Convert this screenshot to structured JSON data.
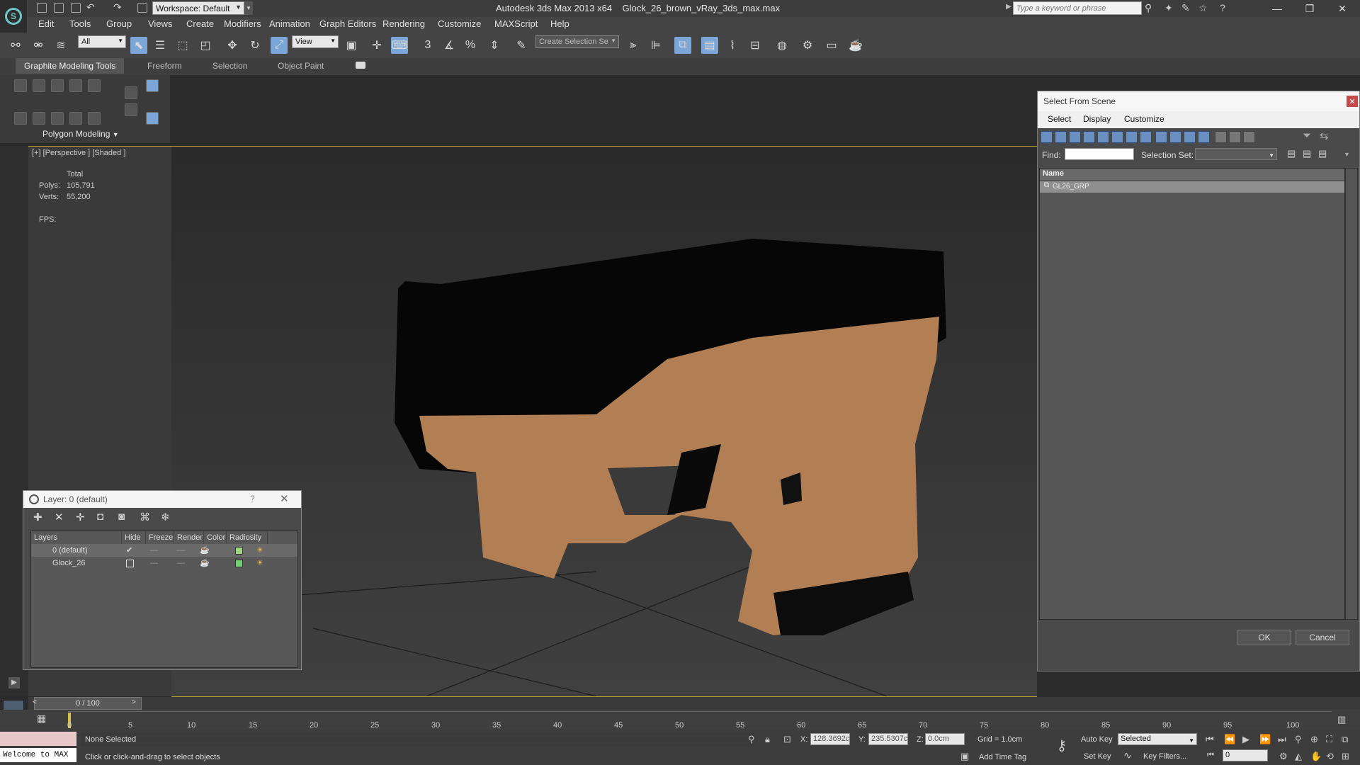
{
  "titlebar": {
    "workspace": "Workspace: Default",
    "app_title": "Autodesk 3ds Max 2013 x64",
    "file_name": "Glock_26_brown_vRay_3ds_max.max",
    "search_placeholder": "Type a keyword or phrase"
  },
  "menu": [
    "Edit",
    "Tools",
    "Group",
    "Views",
    "Create",
    "Modifiers",
    "Animation",
    "Graph Editors",
    "Rendering",
    "Customize",
    "MAXScript",
    "Help"
  ],
  "toolbar": {
    "filter": "All",
    "ref_coord": "View",
    "selection_set": "Create Selection Se"
  },
  "ribbon": {
    "tabs": [
      "Graphite Modeling Tools",
      "Freeform",
      "Selection",
      "Object Paint"
    ],
    "panel_label": "Polygon Modeling"
  },
  "viewport": {
    "label": "[+] [Perspective ] [Shaded ]",
    "stats": {
      "total": "Total",
      "polys_label": "Polys:",
      "polys": "105,791",
      "verts_label": "Verts:",
      "verts": "55,200",
      "fps_label": "FPS:"
    }
  },
  "layer_dialog": {
    "title": "Layer: 0 (default)",
    "help": "?",
    "columns": [
      "Layers",
      "Hide",
      "Freeze",
      "Render",
      "Color",
      "Radiosity"
    ],
    "rows": [
      {
        "name": "0 (default)",
        "current": true,
        "color": "#a8e08a"
      },
      {
        "name": "Glock_26",
        "current": false,
        "color": "#6ed36e"
      }
    ]
  },
  "select_from_scene": {
    "title": "Select From Scene",
    "menu": [
      "Select",
      "Display",
      "Customize"
    ],
    "find_label": "Find:",
    "selection_set_label": "Selection Set:",
    "column_name": "Name",
    "items": [
      "GL26_GRP"
    ],
    "ok": "OK",
    "cancel": "Cancel"
  },
  "timeline": {
    "slider": "0 / 100",
    "ticks": [
      "0",
      "5",
      "10",
      "15",
      "20",
      "25",
      "30",
      "35",
      "40",
      "45",
      "50",
      "55",
      "60",
      "65",
      "70",
      "75",
      "80",
      "85",
      "90",
      "95",
      "100"
    ]
  },
  "status": {
    "welcome": "Welcome to MAX",
    "selection": "None Selected",
    "prompt": "Click or click-and-drag to select objects",
    "x_label": "X:",
    "x": "128.3692c",
    "y_label": "Y:",
    "y": "235.5307c",
    "z_label": "Z:",
    "z": "0.0cm",
    "grid": "Grid = 1.0cm",
    "auto_key": "Auto Key",
    "set_key": "Set Key",
    "key_mode": "Selected",
    "key_filters": "Key Filters...",
    "add_time_tag": "Add Time Tag",
    "frame": "0"
  }
}
